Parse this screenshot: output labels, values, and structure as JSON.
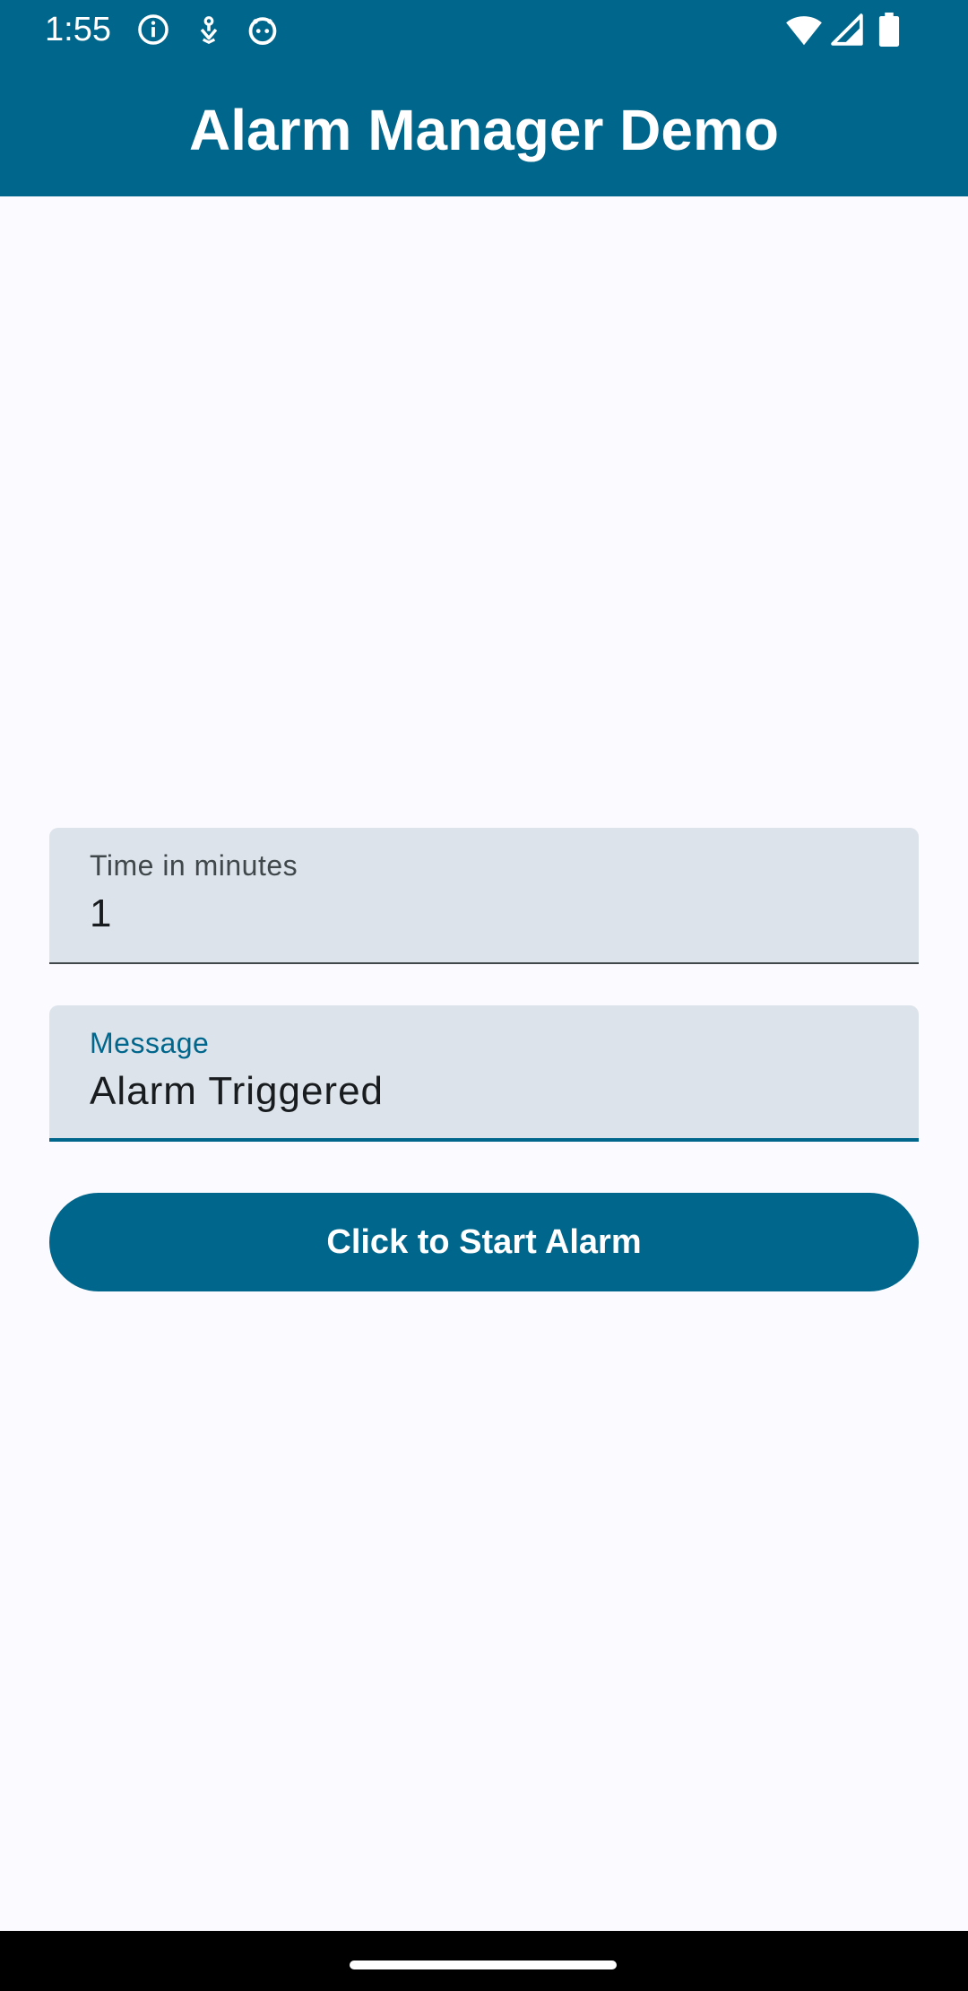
{
  "status_bar": {
    "time": "1:55",
    "left_icons": [
      "info-icon",
      "usb-debug-icon",
      "android-debug-icon"
    ],
    "right_icons": [
      "wifi-icon",
      "cell-signal-icon",
      "battery-icon"
    ]
  },
  "app_bar": {
    "title": "Alarm Manager Demo"
  },
  "form": {
    "time_field": {
      "label": "Time in minutes",
      "value": "1"
    },
    "message_field": {
      "label": "Message",
      "value": "Alarm Triggered",
      "focused": true
    },
    "start_button_label": "Click to Start Alarm"
  },
  "colors": {
    "primary": "#00668b",
    "background": "#fafaff",
    "field_background": "#dde3ea",
    "on_primary": "#ffffff"
  }
}
